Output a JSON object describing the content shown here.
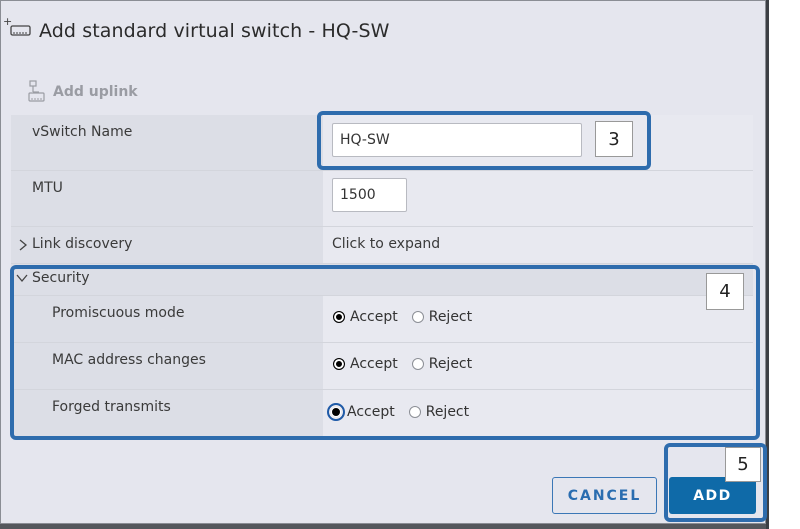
{
  "dialog": {
    "title": "Add standard virtual switch - HQ-SW",
    "add_uplink_label": "Add uplink"
  },
  "form": {
    "vswitch_name": {
      "label": "vSwitch Name",
      "value": "HQ-SW"
    },
    "mtu": {
      "label": "MTU",
      "value": "1500"
    },
    "link_discovery": {
      "label": "Link discovery",
      "value": "Click to expand"
    },
    "security": {
      "label": "Security",
      "options": {
        "accept": "Accept",
        "reject": "Reject"
      },
      "rows": [
        {
          "label": "Promiscuous mode",
          "selected": "Accept"
        },
        {
          "label": "MAC address changes",
          "selected": "Accept"
        },
        {
          "label": "Forged transmits",
          "selected": "Accept"
        }
      ]
    }
  },
  "annotations": {
    "step3": "3",
    "step4": "4",
    "step5": "5"
  },
  "buttons": {
    "cancel": "CANCEL",
    "add": "ADD"
  },
  "colors": {
    "highlight": "#2e6cad",
    "primary": "#0f6aa8"
  }
}
